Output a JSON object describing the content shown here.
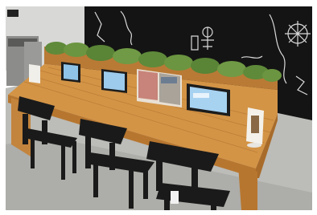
{
  "scene": {
    "description_tags": [
      "counter",
      "tablets",
      "chairs",
      "chalkboard-wall",
      "planter"
    ],
    "colors": {
      "wall": "#141414",
      "chalk": "#d9d9d9",
      "floor": "#b9b9b5",
      "wood_top": "#c98c45",
      "wood_side": "#b87a36",
      "plants": "#5f8a3a",
      "chair": "#1a1a1a",
      "tablet_frame": "#1c1c1c",
      "tablet_screen": "#8fc3e8"
    }
  }
}
